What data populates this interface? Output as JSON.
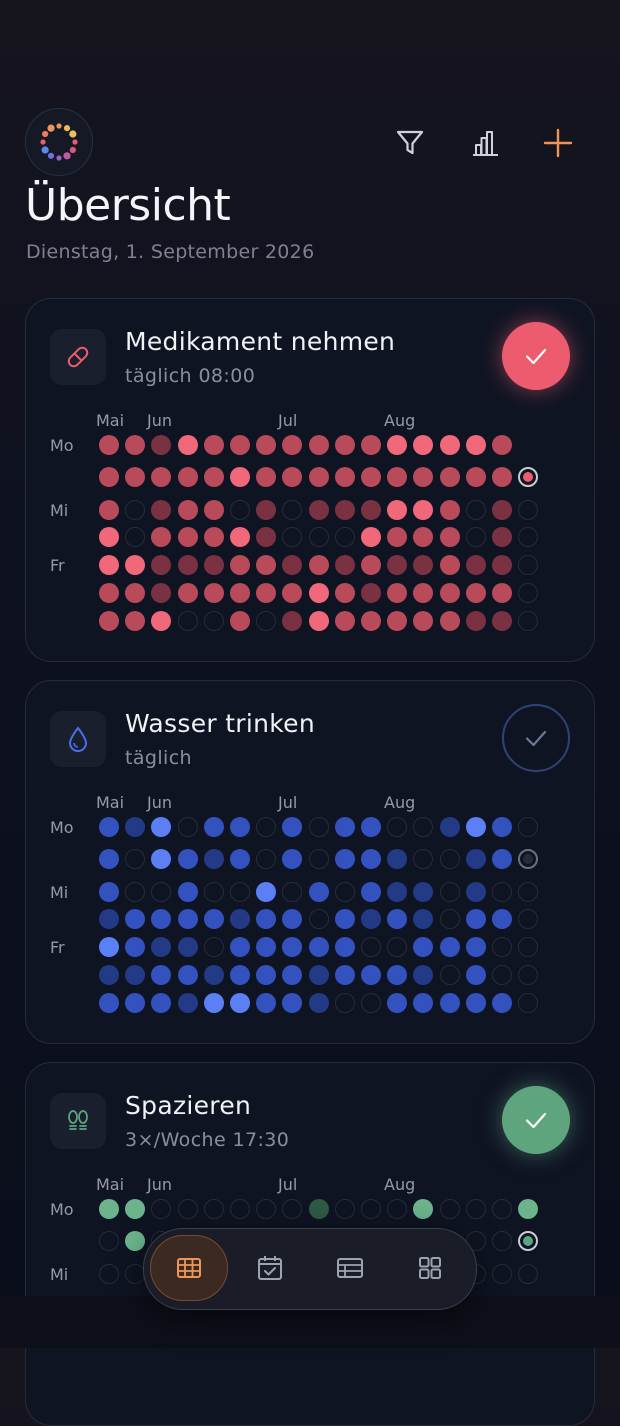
{
  "header": {
    "title": "Übersicht",
    "date": "Dienstag, 1. September 2026",
    "logo_icon": "dotted-ring-logo-icon",
    "actions": [
      {
        "name": "filter-icon"
      },
      {
        "name": "stats-icon"
      },
      {
        "name": "add-icon"
      }
    ]
  },
  "day_labels": [
    "Mo",
    "Mi",
    "Fr"
  ],
  "month_labels": [
    "Mai",
    "Jun",
    "Jul",
    "Aug"
  ],
  "legend_note": "",
  "habits": [
    {
      "title": "Medikament nehmen",
      "subtitle": "täglich  08:00",
      "icon": "pill-icon",
      "completed_today": true,
      "color": "#ec5c6e",
      "grid": [
        "2213222222233332",
        "22222322222222222",
        "20122010111332010",
        "30222310003222010",
        "33111221212112110",
        "22122222321222220",
        "22300201322222110"
      ]
    },
    {
      "title": "Wasser trinken",
      "subtitle": "täglich",
      "icon": "drop-icon",
      "completed_today": false,
      "color": "#4a6ef0",
      "grid": [
        "21302202022001320",
        "20321202022100120",
        "20020030202110100",
        "12222122021210220",
        "32110222220022200",
        "11221222122210200",
        "22213322100222220"
      ]
    },
    {
      "title": "Spazieren",
      "subtitle": "3×/Woche  17:30",
      "icon": "footsteps-icon",
      "completed_today": true,
      "color": "#5ea47d",
      "grid": [
        "33000000100030003",
        "03000000000000003",
        "00000000000000000"
      ]
    }
  ],
  "tabbar": {
    "tabs": [
      {
        "name": "tab-overview-grid",
        "icon": "grid-table-icon",
        "active": true
      },
      {
        "name": "tab-calendar",
        "icon": "calendar-check-icon",
        "active": false
      },
      {
        "name": "tab-list",
        "icon": "list-table-icon",
        "active": false
      },
      {
        "name": "tab-widgets",
        "icon": "four-squares-icon",
        "active": false
      }
    ]
  },
  "colors": {
    "accent": "#f0955a",
    "red": "#ec5c6e",
    "blue": "#4a6ef0",
    "green": "#5ea47d"
  }
}
